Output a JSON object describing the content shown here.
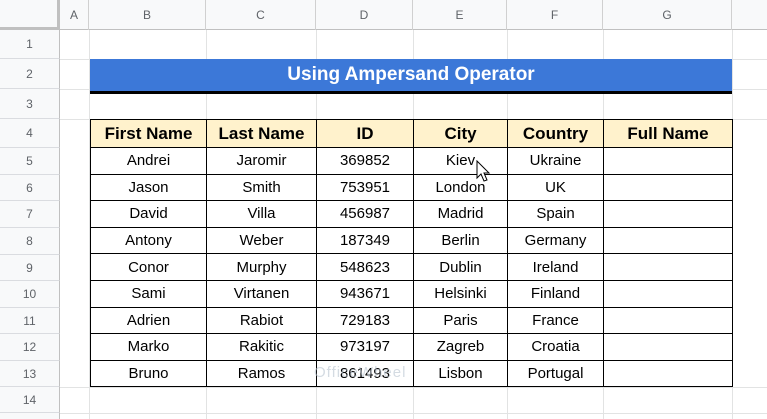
{
  "columns": [
    "A",
    "B",
    "C",
    "D",
    "E",
    "F",
    "G"
  ],
  "rows": [
    "1",
    "2",
    "3",
    "4",
    "5",
    "6",
    "7",
    "8",
    "9",
    "10",
    "11",
    "12",
    "13",
    "14"
  ],
  "title": "Using Ampersand Operator",
  "table": {
    "headers": [
      "First Name",
      "Last Name",
      "ID",
      "City",
      "Country",
      "Full Name"
    ],
    "rows": [
      [
        "Andrei",
        "Jaromir",
        "369852",
        "Kiev",
        "Ukraine",
        ""
      ],
      [
        "Jason",
        "Smith",
        "753951",
        "London",
        "UK",
        ""
      ],
      [
        "David",
        "Villa",
        "456987",
        "Madrid",
        "Spain",
        ""
      ],
      [
        "Antony",
        "Weber",
        "187349",
        "Berlin",
        "Germany",
        ""
      ],
      [
        "Conor",
        "Murphy",
        "548623",
        "Dublin",
        "Ireland",
        ""
      ],
      [
        "Sami",
        "Virtanen",
        "943671",
        "Helsinki",
        "Finland",
        ""
      ],
      [
        "Adrien",
        "Rabiot",
        "729183",
        "Paris",
        "France",
        ""
      ],
      [
        "Marko",
        "Rakitic",
        "973197",
        "Zagreb",
        "Croatia",
        ""
      ],
      [
        "Bruno",
        "Ramos",
        "861493",
        "Lisbon",
        "Portugal",
        ""
      ]
    ]
  },
  "watermark": "OfficeWheel",
  "colors": {
    "title_bg": "#3c78d8",
    "header_bg": "#fff2cc"
  }
}
